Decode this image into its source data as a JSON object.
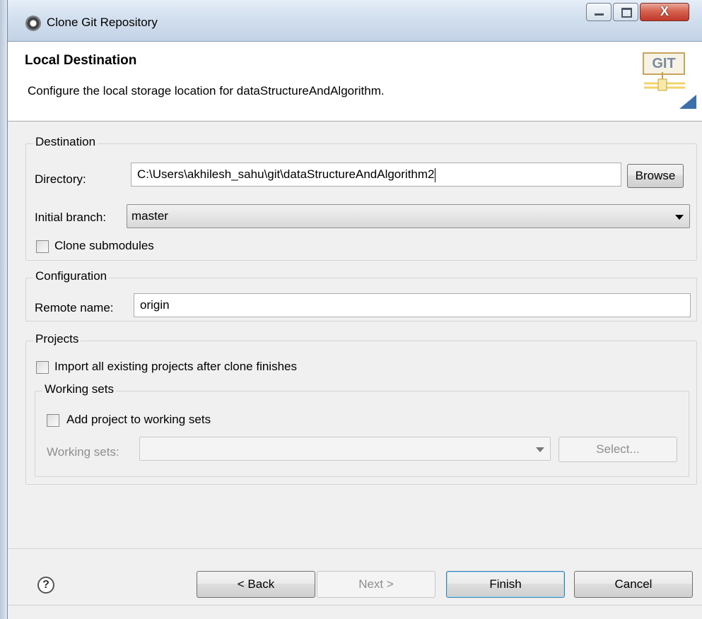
{
  "window": {
    "title": "Clone Git Repository"
  },
  "header": {
    "title": "Local Destination",
    "description": "Configure the local storage location for dataStructureAndAlgorithm.",
    "logo_text": "GIT"
  },
  "destination": {
    "legend": "Destination",
    "directory_label": "Directory:",
    "directory_value": "C:\\Users\\akhilesh_sahu\\git\\dataStructureAndAlgorithm2",
    "browse_label": "Browse",
    "initial_branch_label": "Initial branch:",
    "initial_branch_value": "master",
    "clone_submodules_label": "Clone submodules",
    "clone_submodules_checked": false
  },
  "configuration": {
    "legend": "Configuration",
    "remote_name_label": "Remote name:",
    "remote_name_value": "origin"
  },
  "projects": {
    "legend": "Projects",
    "import_label": "Import all existing projects after clone finishes",
    "import_checked": false,
    "working_sets": {
      "legend": "Working sets",
      "add_label": "Add project to working sets",
      "add_checked": false,
      "working_sets_label": "Working sets:",
      "working_sets_value": "",
      "select_label": "Select..."
    }
  },
  "footer": {
    "back_label": "< Back",
    "next_label": "Next >",
    "finish_label": "Finish",
    "cancel_label": "Cancel"
  },
  "icons": {
    "app": "eclipse-icon",
    "help": "help-icon"
  },
  "colors": {
    "window_bg": "#f0f0f0",
    "default_button_border": "#3c7fb1",
    "close_button": "#c0392b"
  }
}
